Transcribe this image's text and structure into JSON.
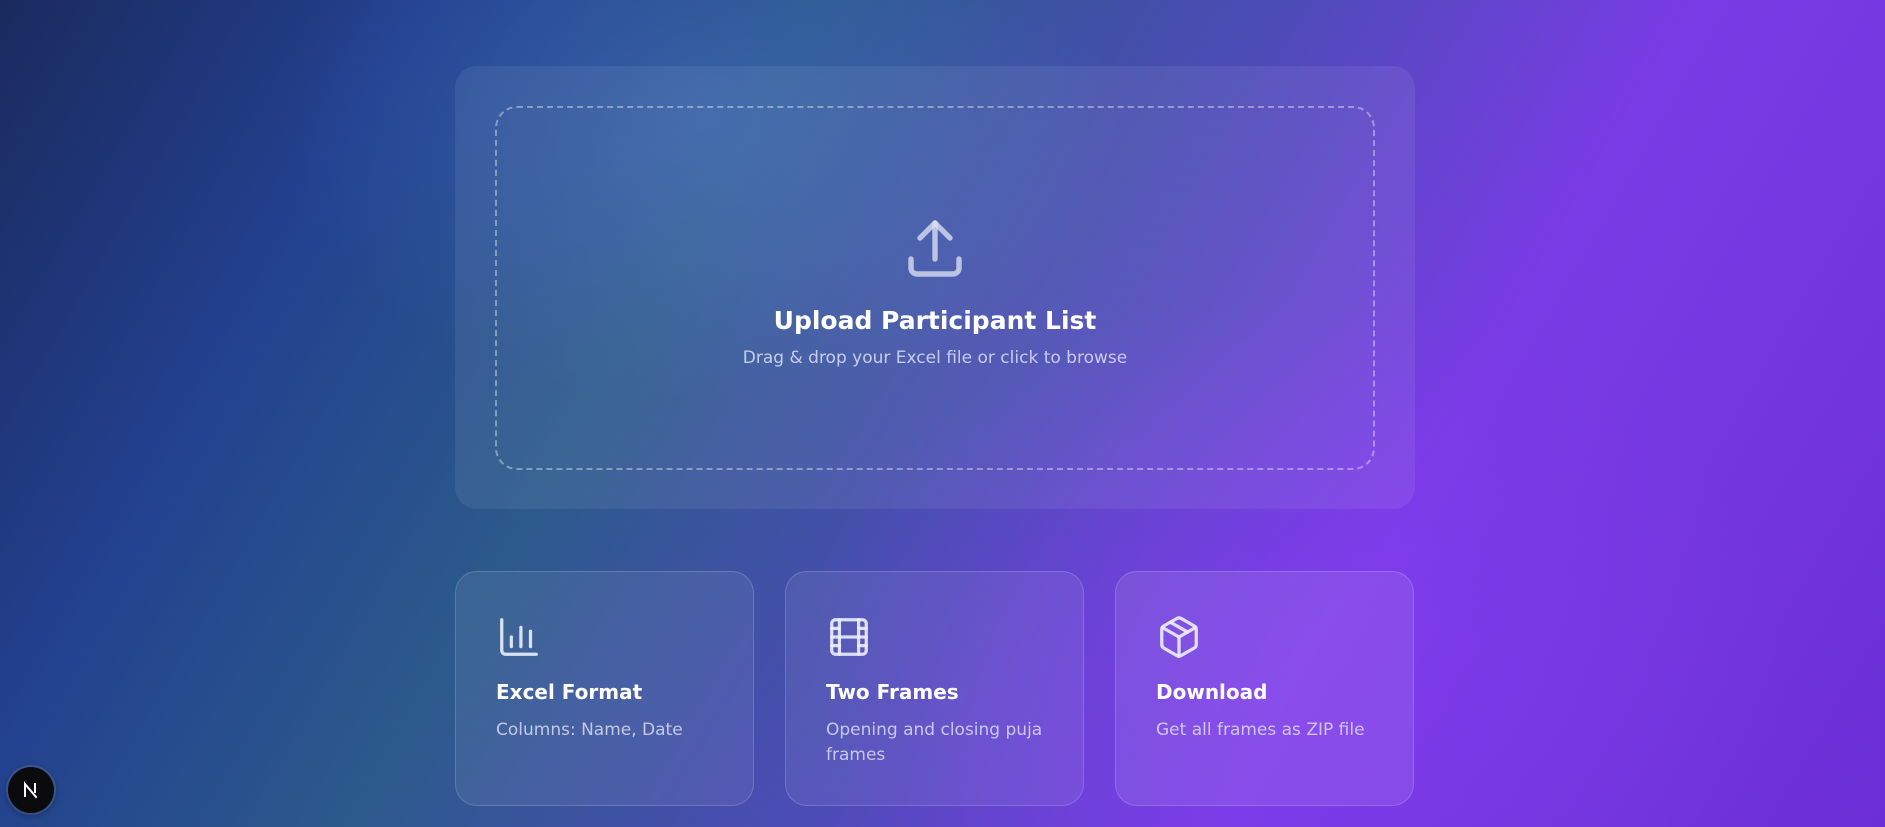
{
  "upload": {
    "icon": "upload-icon",
    "title": "Upload Participant List",
    "subtitle": "Drag & drop your Excel file or click to browse"
  },
  "features": [
    {
      "icon": "bar-chart-icon",
      "title": "Excel Format",
      "description": "Columns: Name, Date"
    },
    {
      "icon": "film-icon",
      "title": "Two Frames",
      "description": "Opening and closing puja frames"
    },
    {
      "icon": "package-icon",
      "title": "Download",
      "description": "Get all frames as ZIP file"
    }
  ],
  "dev_badge": {
    "icon": "nextjs-logo-icon"
  },
  "colors": {
    "background_start": "#1a2a5e",
    "background_mid": "#2c5a8c",
    "background_end": "#7a3ce6",
    "text_primary": "#ffffff"
  }
}
